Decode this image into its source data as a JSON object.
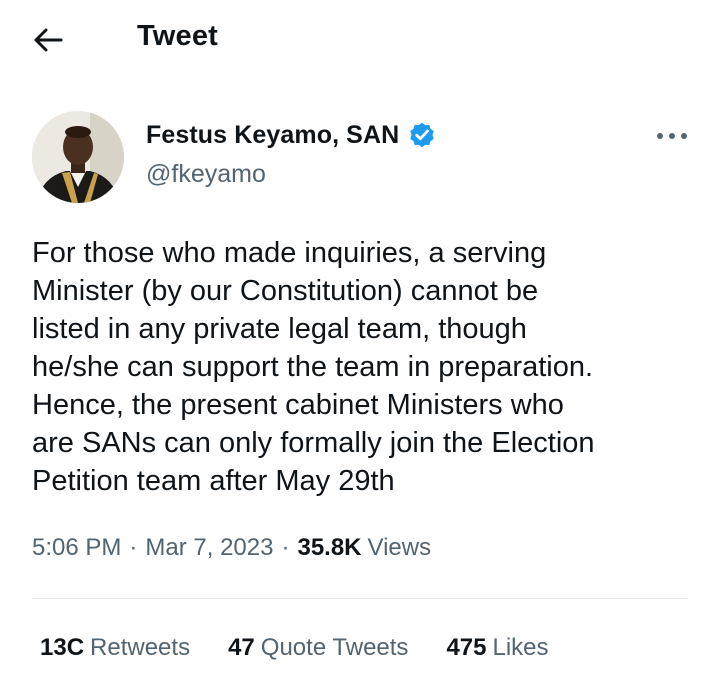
{
  "header": {
    "title": "Tweet",
    "back_icon": "arrow-left-icon"
  },
  "author": {
    "display_name": "Festus Keyamo, SAN",
    "handle": "@fkeyamo",
    "verified_icon": "verified-badge-icon",
    "verified_color": "#1d9bf0"
  },
  "tweet": {
    "text": "For those who made inquiries, a serving\nMinister (by our Constitution) cannot be\nlisted in any private legal team, though\nhe/she can support the team in preparation.\nHence, the present cabinet Ministers who\nare SANs can only formally join the Election\nPetition team after May 29th",
    "time": "5:06 PM",
    "separator": "·",
    "date": "Mar 7, 2023",
    "views_count": "35.8K",
    "views_label": "Views"
  },
  "stats": {
    "retweets_count": "13C",
    "retweets_label": "Retweets",
    "quotes_count": "47",
    "quotes_label": "Quote Tweets",
    "likes_count": "475",
    "likes_label": "Likes"
  },
  "more_icon": "more-horizontal-icon"
}
